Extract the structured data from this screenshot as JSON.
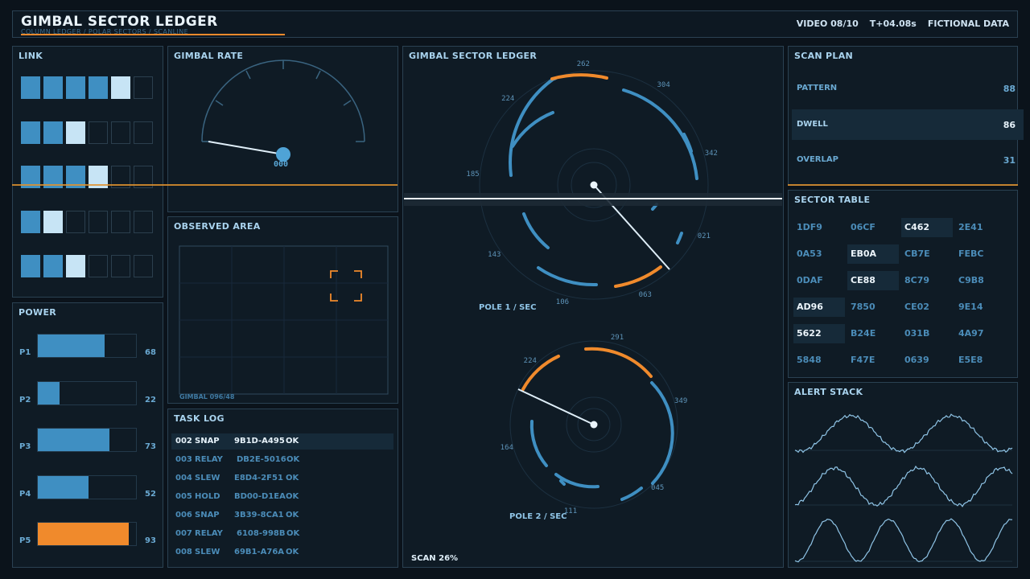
{
  "header": {
    "title": "GIMBAL SECTOR LEDGER",
    "subtitle": "COLUMN LEDGER / POLAR SECTORS / SCANLINE",
    "video": "VIDEO 08/10",
    "time": "T+04.08s",
    "note": "FICTIONAL DATA"
  },
  "link": {
    "title": "LINK",
    "rows": [
      [
        1,
        1,
        1,
        1,
        2,
        0
      ],
      [
        1,
        1,
        2,
        0,
        0,
        0
      ],
      [
        1,
        1,
        1,
        2,
        0,
        0
      ],
      [
        1,
        2,
        0,
        0,
        0,
        0
      ],
      [
        1,
        1,
        2,
        0,
        0,
        0
      ]
    ]
  },
  "power": {
    "title": "POWER",
    "items": [
      {
        "label": "P1",
        "value": 68,
        "color": "#3f8fc2"
      },
      {
        "label": "P2",
        "value": 22,
        "color": "#3f8fc2"
      },
      {
        "label": "P3",
        "value": 73,
        "color": "#3f8fc2"
      },
      {
        "label": "P4",
        "value": 52,
        "color": "#3f8fc2"
      },
      {
        "label": "P5",
        "value": 93,
        "color": "#f08a2c"
      }
    ]
  },
  "gimbal_rate": {
    "title": "GIMBAL RATE",
    "readout": "000"
  },
  "observed_area": {
    "title": "OBSERVED AREA",
    "footer": "GIMBAL 096/48"
  },
  "task_log": {
    "title": "TASK LOG",
    "rows": [
      {
        "id": "002",
        "op": "SNAP",
        "code": "9B1D-A495",
        "status": "OK",
        "selected": true
      },
      {
        "id": "003",
        "op": "RELAY",
        "code": "DB2E-5016",
        "status": "OK",
        "selected": false
      },
      {
        "id": "004",
        "op": "SLEW",
        "code": "E8D4-2F51",
        "status": "OK",
        "selected": false
      },
      {
        "id": "005",
        "op": "HOLD",
        "code": "BD00-D1EA",
        "status": "OK",
        "selected": false
      },
      {
        "id": "006",
        "op": "SNAP",
        "code": "3B39-8CA1",
        "status": "OK",
        "selected": false
      },
      {
        "id": "007",
        "op": "RELAY",
        "code": "6108-998B",
        "status": "OK",
        "selected": false
      },
      {
        "id": "008",
        "op": "SLEW",
        "code": "69B1-A76A",
        "status": "OK",
        "selected": false
      }
    ]
  },
  "sector_ledger": {
    "title": "GIMBAL SECTOR LEDGER",
    "pole1": {
      "label": "POLE 1 / SEC",
      "ticks": [
        "262",
        "304",
        "342",
        "021",
        "063",
        "106",
        "143",
        "185",
        "224"
      ]
    },
    "pole2": {
      "label": "POLE 2 / SEC",
      "ticks": [
        "291",
        "349",
        "045",
        "111",
        "164",
        "224"
      ]
    },
    "scan": "SCAN 26%"
  },
  "scan_plan": {
    "title": "SCAN PLAN",
    "rows": [
      {
        "name": "PATTERN",
        "value": "88",
        "selected": false
      },
      {
        "name": "DWELL",
        "value": "86",
        "selected": true
      },
      {
        "name": "OVERLAP",
        "value": "31",
        "selected": false
      }
    ]
  },
  "sector_table": {
    "title": "SECTOR TABLE",
    "cells": [
      [
        "1DF9",
        "06CF",
        "C462",
        "2E41"
      ],
      [
        "0A53",
        "EB0A",
        "CB7E",
        "FEBC"
      ],
      [
        "0DAF",
        "CE88",
        "8C79",
        "C9B8"
      ],
      [
        "AD96",
        "7850",
        "CE02",
        "9E14"
      ],
      [
        "5622",
        "B24E",
        "031B",
        "4A97"
      ],
      [
        "5848",
        "F47E",
        "0639",
        "E5E8"
      ]
    ],
    "highlighted": [
      [
        0,
        2
      ],
      [
        1,
        1
      ],
      [
        2,
        1
      ],
      [
        3,
        0
      ],
      [
        4,
        0
      ]
    ]
  },
  "alert_stack": {
    "title": "ALERT STACK"
  },
  "colors": {
    "accent_blue": "#3f8fc2",
    "accent_orange": "#f08a2c",
    "highlight": "#c7e4f5"
  }
}
